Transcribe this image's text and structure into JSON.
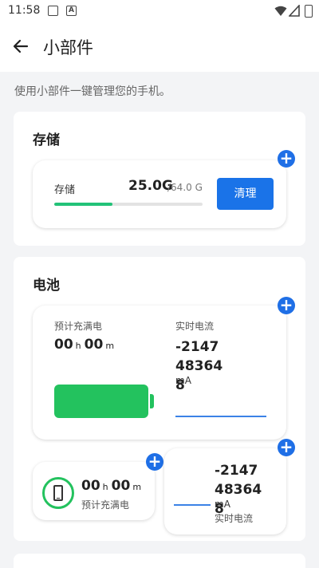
{
  "status_bar": {
    "time": "11:58",
    "notif_icon_2": "A"
  },
  "app_bar": {
    "title": "小部件"
  },
  "subtitle": "使用小部件一键管理您的手机。",
  "storage": {
    "section_title": "存储",
    "label": "存储",
    "used": "25.0G",
    "total": "/64.0 G",
    "used_fraction": 0.39,
    "clean_label": "清理"
  },
  "battery": {
    "section_title": "电池",
    "big_card": {
      "charge_label": "预计充满电",
      "hours": "00",
      "hours_unit": "h",
      "minutes": "00",
      "minutes_unit": "m",
      "current_label": "实时电流",
      "current_value": "-2147483648",
      "current_unit": "mA"
    },
    "small_card_left": {
      "hours": "00",
      "hours_unit": "h",
      "minutes": "00",
      "minutes_unit": "m",
      "label": "预计充满电"
    },
    "small_card_right": {
      "current_value": "-2147483648",
      "current_unit": "mA",
      "label": "实时电流"
    }
  },
  "colors": {
    "accent_blue": "#1f6fe6",
    "button_blue": "#1a73e8",
    "battery_green": "#23c25e",
    "progress_green": "#23c278"
  },
  "icons": {
    "back": "arrow-left-icon",
    "add": "plus-icon",
    "phone": "phone-icon",
    "battery": "battery-icon"
  }
}
